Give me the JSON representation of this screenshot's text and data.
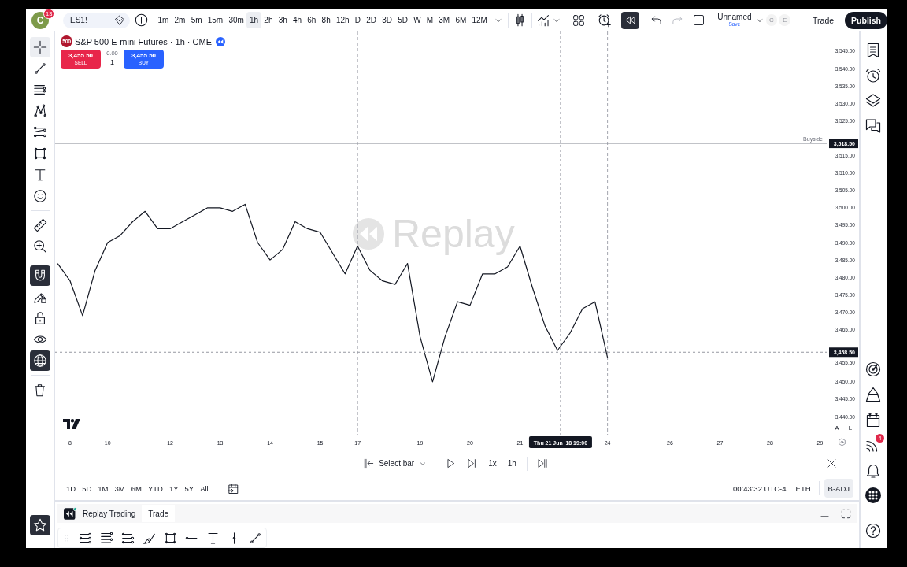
{
  "top_toolbar": {
    "avatar": {
      "letter": "C",
      "badge": "13"
    },
    "symbol_search": {
      "value": "ES1!"
    },
    "intervals": [
      {
        "label": "1m",
        "selected": false
      },
      {
        "label": "2m",
        "selected": false
      },
      {
        "label": "5m",
        "selected": false
      },
      {
        "label": "15m",
        "selected": false
      },
      {
        "label": "30m",
        "selected": false
      },
      {
        "label": "1h",
        "selected": true
      },
      {
        "label": "2h",
        "selected": false
      },
      {
        "label": "3h",
        "selected": false
      },
      {
        "label": "4h",
        "selected": false
      },
      {
        "label": "6h",
        "selected": false
      },
      {
        "label": "8h",
        "selected": false
      },
      {
        "label": "12h",
        "selected": false
      },
      {
        "label": "D",
        "selected": false
      },
      {
        "label": "2D",
        "selected": false
      },
      {
        "label": "3D",
        "selected": false
      },
      {
        "label": "5D",
        "selected": false
      },
      {
        "label": "W",
        "selected": false
      },
      {
        "label": "M",
        "selected": false
      },
      {
        "label": "3M",
        "selected": false
      },
      {
        "label": "6M",
        "selected": false
      },
      {
        "label": "12M",
        "selected": false
      }
    ],
    "replay": {
      "on": true
    },
    "layout": {
      "name": "Unnamed",
      "save": "Save"
    },
    "collaborators": [
      "C",
      "E"
    ],
    "trade_button": "Trade",
    "publish_button": "Publish"
  },
  "left_toolbar": {
    "tools": [
      {
        "selected": true
      },
      {
        "selected": false
      },
      {
        "selected": false
      },
      {
        "selected": false
      },
      {
        "selected": false
      },
      {
        "selected": false
      },
      {
        "selected": false
      },
      {
        "selected": false
      },
      {
        "selected": false
      },
      {
        "selected": false
      }
    ],
    "toggles": [
      {
        "on": true
      },
      {
        "on": false
      },
      {
        "on": false
      },
      {
        "on": false
      },
      {
        "on": true
      }
    ],
    "favorites": {
      "on": true
    }
  },
  "legend": {
    "badge": "500",
    "title": "S&P 500 E-mini Futures · 1h · CME",
    "sell": {
      "price": "3,455.50",
      "label": "SELL"
    },
    "spread": "0.00",
    "quantity": "1",
    "buy": {
      "price": "3,455.50",
      "label": "BUY"
    }
  },
  "chart": {
    "watermark": "Replay",
    "scale_buttons": [
      "A",
      "L"
    ],
    "crosshair_time": "Thu 21 Jun '18 19:00",
    "chart_data": {
      "type": "line",
      "categories": [
        null,
        "8",
        null,
        null,
        "10",
        null,
        null,
        null,
        null,
        "12",
        null,
        null,
        null,
        "13",
        null,
        null,
        null,
        "14",
        null,
        null,
        null,
        "15",
        null,
        null,
        "17",
        null,
        null,
        null,
        null,
        "19",
        null,
        null,
        null,
        "20",
        null,
        null,
        null,
        "21",
        null,
        null,
        null,
        null,
        null,
        null,
        "24",
        null,
        null,
        null,
        null,
        "26",
        null,
        null,
        null,
        "27",
        null,
        null,
        null,
        "28",
        null,
        null,
        null,
        "29"
      ],
      "values": [
        3484,
        3479,
        3469,
        3482,
        3490,
        3492,
        3496,
        3499,
        3494,
        3494,
        3496,
        3498,
        3500,
        3500,
        3499,
        3501,
        3490,
        3485,
        3488,
        3496,
        3494,
        3493,
        3487,
        3481,
        3489,
        3482,
        3479,
        3478,
        3484,
        3463,
        3450,
        3463,
        3473,
        3472,
        3481,
        3481,
        3483,
        3489,
        3477,
        3466,
        3459,
        3464,
        3471,
        3473,
        3457,
        null,
        null,
        null,
        null,
        null,
        null,
        null,
        null,
        null,
        null,
        null,
        null,
        null,
        null,
        null,
        null,
        null
      ],
      "ylim": [
        3434.8,
        3550.65
      ],
      "yticks": [
        {
          "value": 3545,
          "label": "3,545.00"
        },
        {
          "value": 3540,
          "label": "3,540.00"
        },
        {
          "value": 3535,
          "label": "3,535.00"
        },
        {
          "value": 3530,
          "label": "3,530.00"
        },
        {
          "value": 3525,
          "label": "3,525.00"
        },
        {
          "value": 3518.5,
          "label": "3,518.50"
        },
        {
          "value": 3515,
          "label": "3,515.00"
        },
        {
          "value": 3510,
          "label": "3,510.00"
        },
        {
          "value": 3505,
          "label": "3,505.00"
        },
        {
          "value": 3500,
          "label": "3,500.00"
        },
        {
          "value": 3495,
          "label": "3,495.00"
        },
        {
          "value": 3490,
          "label": "3,490.00"
        },
        {
          "value": 3485,
          "label": "3,485.00"
        },
        {
          "value": 3480,
          "label": "3,480.00"
        },
        {
          "value": 3475,
          "label": "3,475.00"
        },
        {
          "value": 3470,
          "label": "3,470.00"
        },
        {
          "value": 3465,
          "label": "3,465.00"
        },
        {
          "value": 3458.5,
          "label": "3,458.50"
        },
        {
          "value": 3455.5,
          "label": "3,455.50"
        },
        {
          "value": 3450,
          "label": "3,450.00"
        },
        {
          "value": 3445,
          "label": "3,445.00"
        },
        {
          "value": 3440,
          "label": "3,440.00"
        }
      ],
      "ref_lines": [
        {
          "axis": "x",
          "value": "17"
        },
        {
          "axis": "x",
          "value": "24"
        },
        {
          "axis": "y",
          "value": 3518.5,
          "label": "Buyside"
        },
        {
          "axis": "y",
          "value": 3458.5
        }
      ]
    }
  },
  "replay_bar": {
    "select_bar": "Select bar",
    "speed": "1x",
    "interval": "1h"
  },
  "range_bar": {
    "ranges": [
      "1D",
      "5D",
      "1M",
      "3M",
      "6M",
      "YTD",
      "1Y",
      "5Y",
      "All"
    ],
    "clock": "00:43:32 UTC-4",
    "session": "ETH",
    "adjustment": {
      "label": "B-ADJ",
      "on": true
    }
  },
  "bottom_panel": {
    "title": "Replay Trading",
    "trade_button": "Trade"
  },
  "right_sidebar": {
    "feed_badge": "4"
  }
}
